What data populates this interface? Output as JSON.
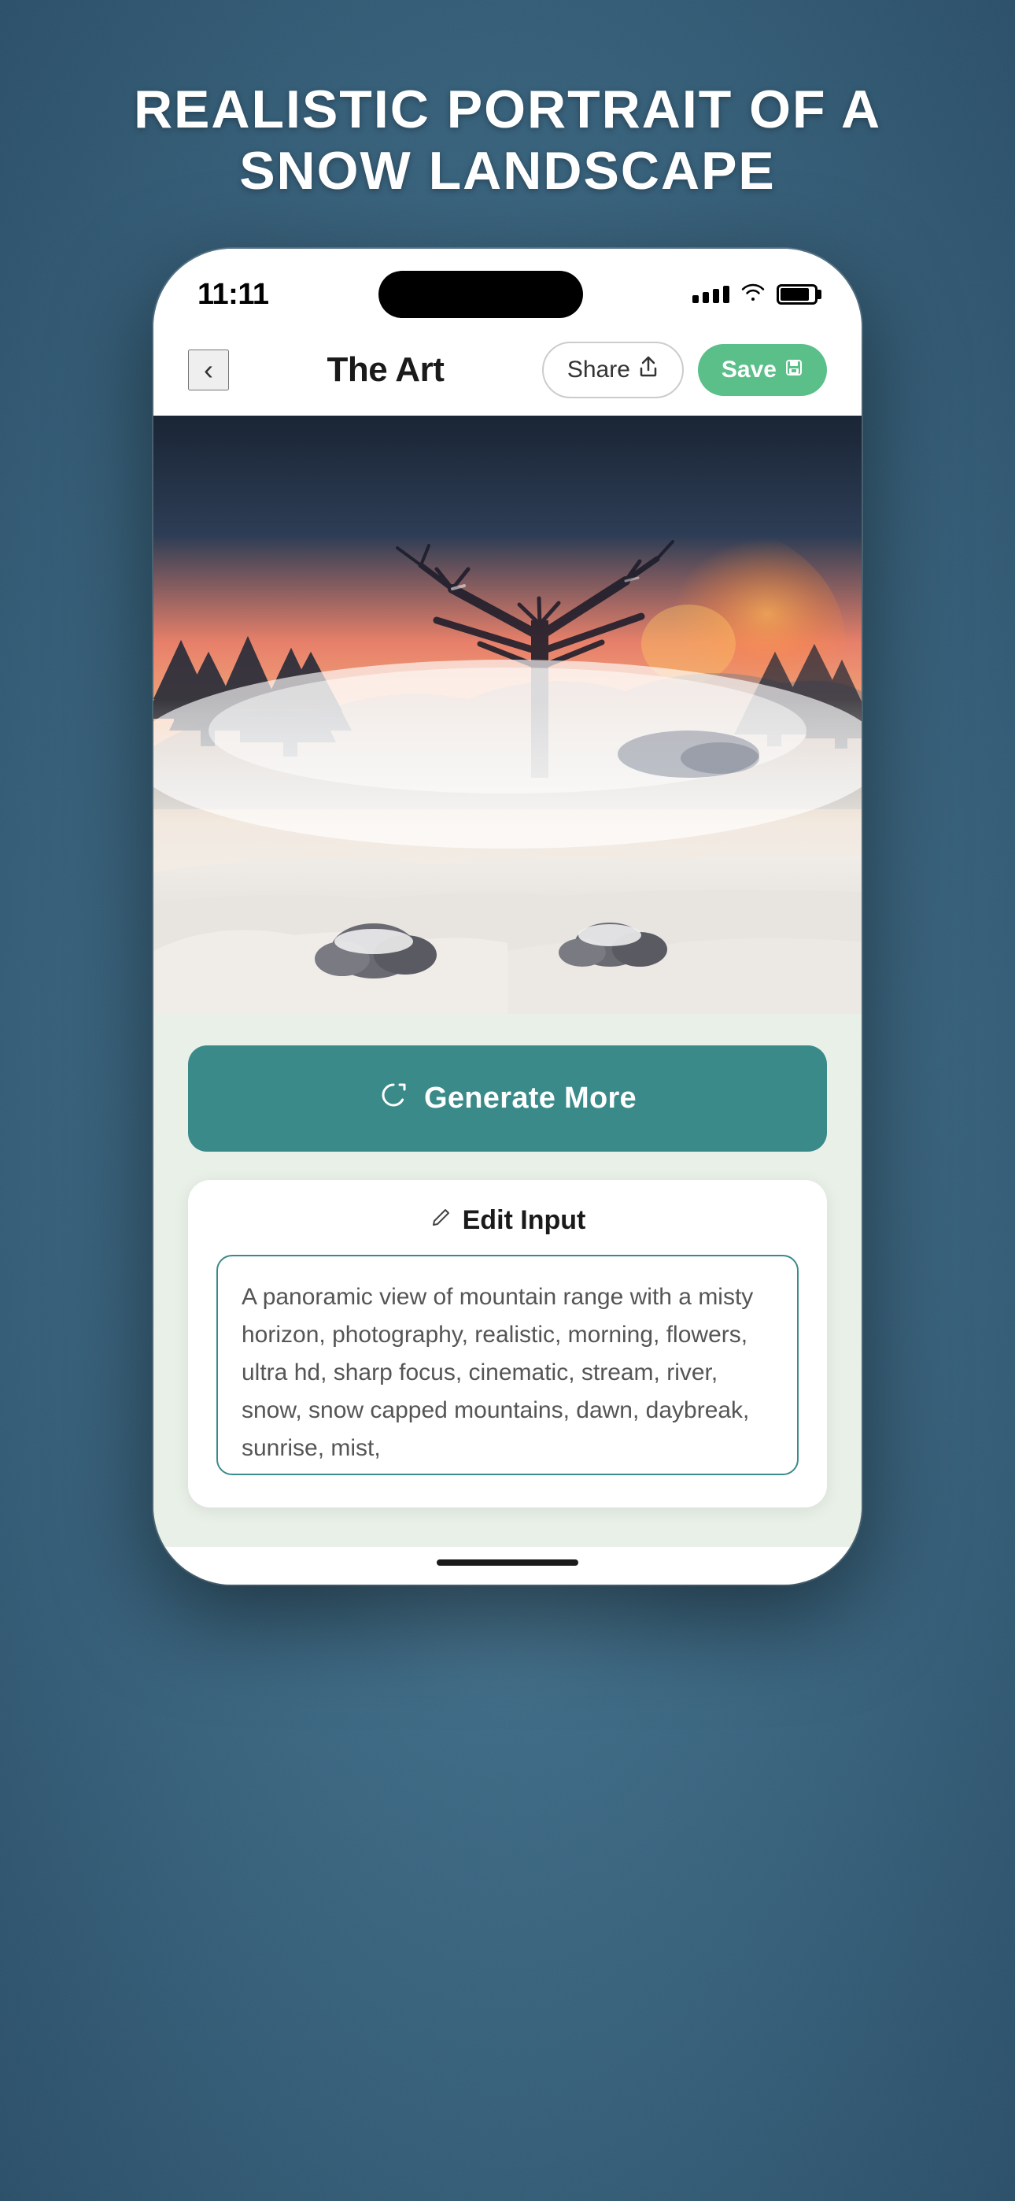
{
  "page": {
    "title": "REALISTIC PORTRAIT OF A\nSNOW LANDSCAPE"
  },
  "status_bar": {
    "time": "11:11",
    "signal_label": "signal",
    "wifi_label": "wifi",
    "battery_label": "battery"
  },
  "nav": {
    "back_label": "‹",
    "title": "The Art",
    "share_label": "Share",
    "save_label": "Save"
  },
  "generate": {
    "button_label": "Generate More",
    "icon_label": "↻"
  },
  "edit_input": {
    "section_title": "Edit Input",
    "prompt_text": "A panoramic view of mountain range with a misty horizon, photography, realistic, morning, flowers, ultra hd, sharp focus, cinematic, stream, river, snow, snow capped mountains, dawn, daybreak, sunrise, mist,",
    "pencil_symbol": "✏"
  },
  "colors": {
    "teal": "#3a8a8a",
    "green_save": "#5bbf8a",
    "light_green_bg": "#e8f0e8",
    "white": "#ffffff"
  }
}
